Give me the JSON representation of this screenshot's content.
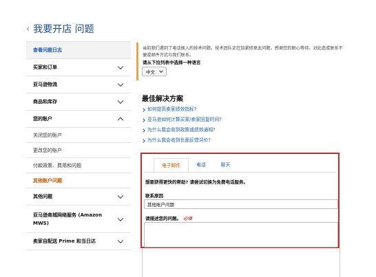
{
  "header": {
    "back_icon": "chevron-left-icon",
    "title": "我要开店 问题"
  },
  "sidebar": {
    "items": [
      {
        "label": "查看问题日志",
        "type": "first"
      },
      {
        "label": "买家和订单",
        "type": "head",
        "chevron": "down"
      },
      {
        "label": "亚马逊物流",
        "type": "head",
        "chevron": "down"
      },
      {
        "label": "商品和库存",
        "type": "head",
        "chevron": "down"
      },
      {
        "label": "您的账户",
        "type": "head",
        "chevron": "up"
      },
      {
        "label": "关闭您的账户",
        "type": "sub"
      },
      {
        "label": "更改您的账户",
        "type": "sub"
      },
      {
        "label": "付款政策、费用和问题",
        "type": "sub"
      },
      {
        "label": "其他账户问题",
        "type": "active"
      },
      {
        "label": "其他问题",
        "type": "head",
        "chevron": "down"
      },
      {
        "label": "亚马逊商城网络服务 (Amazon MWS)",
        "type": "two",
        "chevron": "down"
      },
      {
        "label": "卖家自配送 Prime 和当日达",
        "type": "head",
        "chevron": "down"
      }
    ]
  },
  "notice": {
    "message": "当前我们遇到了电话拨入的技术问题。技术团队正在加紧修复此问题。感谢您的耐心等待。对此造成联系不便或邮件方式与我们联系。",
    "language_label": "请从下拉列表中选择一种语言",
    "language_value": "中文"
  },
  "best": {
    "title": "最佳解决方案",
    "links": [
      "如何提高卖家绩效指标?",
      "亚马逊如何计算买家/卖家回复时间?",
      "为什么我会收到政策或绩效通知?",
      "为什么我会收到负面反馈评价?"
    ]
  },
  "contact": {
    "tabs": [
      "电子邮件",
      "电话",
      "聊天"
    ],
    "help_text": "想要获得更快的帮助? 请尝试切换为免费电话服务。",
    "reason_label": "联系原因",
    "reason_value": "其他账户问题",
    "desc_label": "请描述您的问题。",
    "required": "必填"
  },
  "colors": {
    "link": "#1f5fa8",
    "active": "#c45500",
    "notice_bar": "#e9a44c",
    "highlight_border": "#d1272b"
  }
}
